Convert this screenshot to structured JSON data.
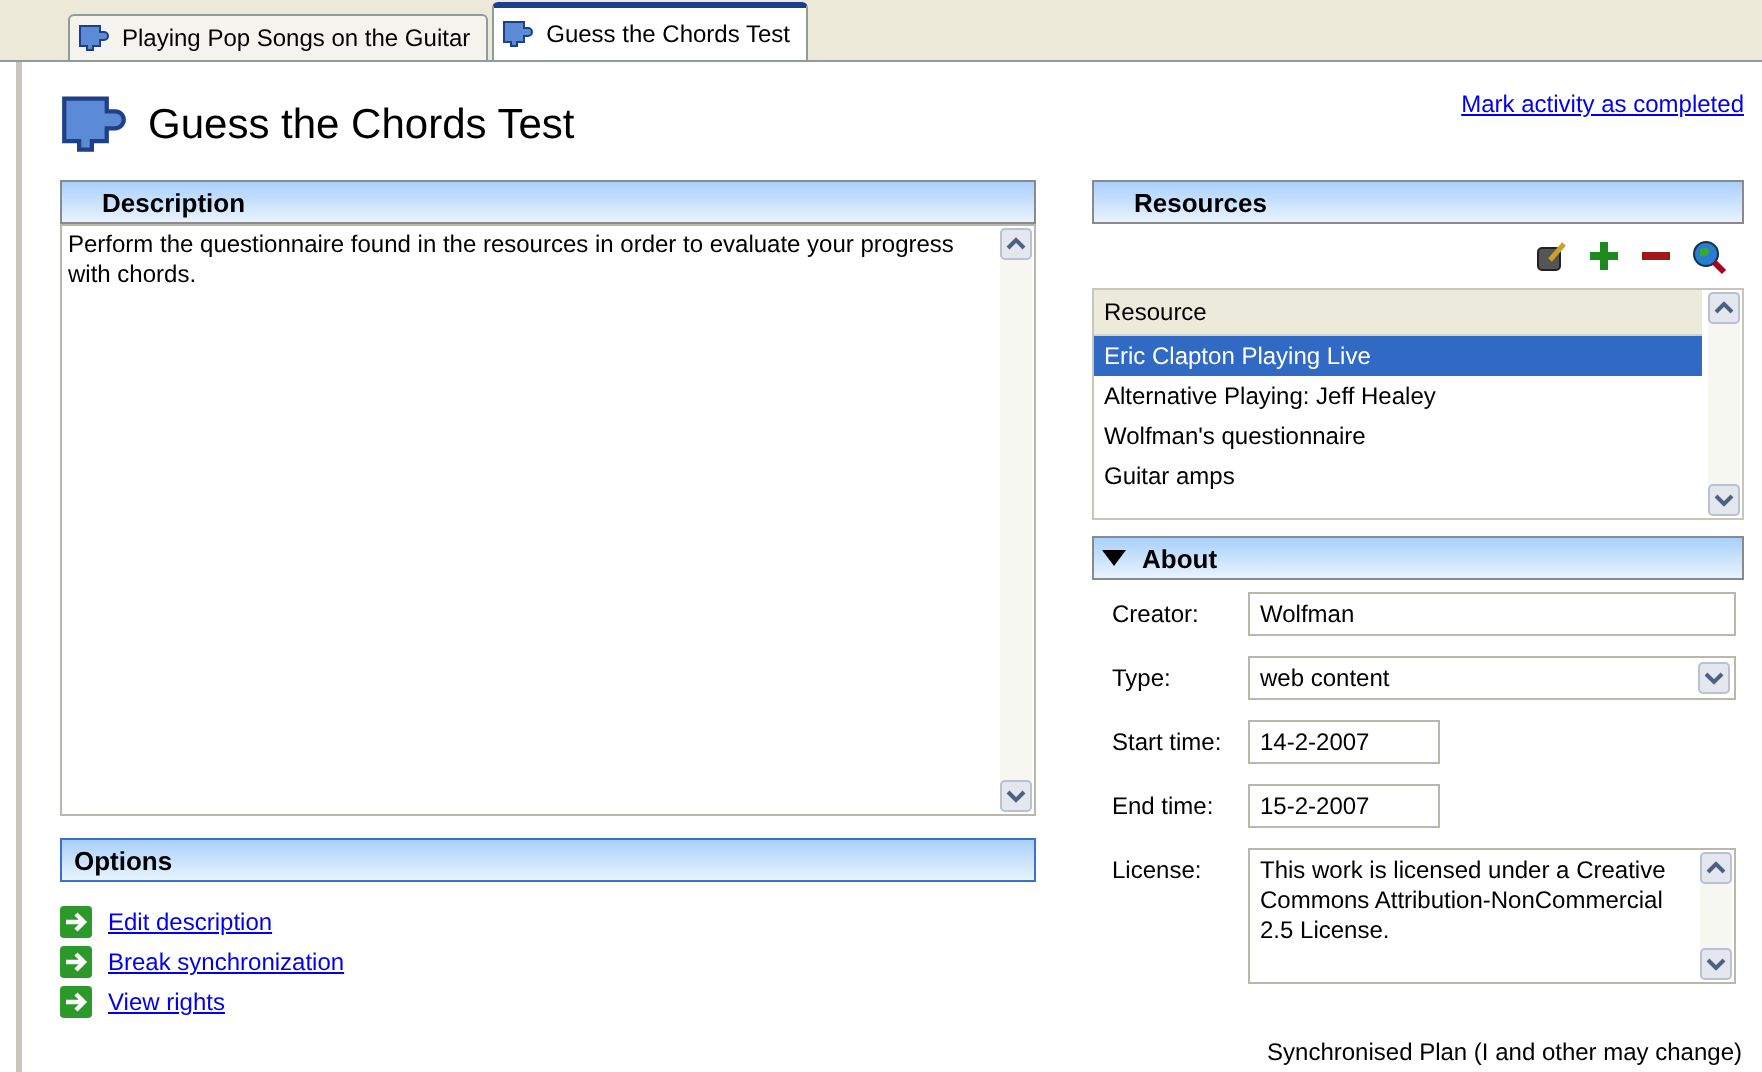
{
  "tabs": [
    {
      "label": "Playing Pop Songs on the Guitar",
      "selected": false
    },
    {
      "label": "Guess the Chords Test",
      "selected": true
    }
  ],
  "header": {
    "title": "Guess the Chords Test",
    "link": "Mark activity as completed"
  },
  "description": {
    "heading": "Description",
    "text": "Perform the questionnaire found in the resources in order to evaluate your progress with chords."
  },
  "options": {
    "heading": "Options",
    "links": [
      "Edit description",
      "Break synchronization",
      "View rights"
    ]
  },
  "resources": {
    "heading": "Resources",
    "column": "Resource",
    "rows": [
      {
        "label": "Eric Clapton Playing Live",
        "selected": true
      },
      {
        "label": "Alternative Playing: Jeff Healey",
        "selected": false
      },
      {
        "label": "Wolfman's questionnaire",
        "selected": false
      },
      {
        "label": "Guitar amps",
        "selected": false
      }
    ]
  },
  "about": {
    "heading": "About",
    "expanded": true,
    "fields": [
      {
        "kind": "text",
        "label": "Creator:",
        "value": "Wolfman"
      },
      {
        "kind": "select",
        "label": "Type:",
        "value": "web content"
      },
      {
        "kind": "date",
        "label": "Start time:",
        "value": "14-2-2007"
      },
      {
        "kind": "date",
        "label": "End time:",
        "value": "15-2-2007"
      },
      {
        "kind": "textarea",
        "label": "License:",
        "value": "This work is licensed under a Creative Commons Attribution-NonCommercial 2.5 License."
      }
    ]
  },
  "status": "Synchronised Plan (I and other may change)"
}
